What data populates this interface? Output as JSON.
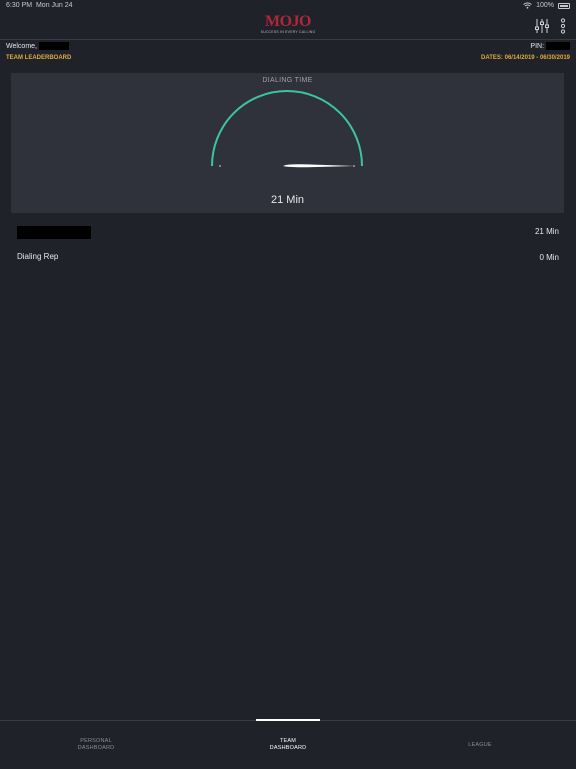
{
  "status_bar": {
    "time": "6:30 PM",
    "date": "Mon Jun 24",
    "battery": "100%"
  },
  "header": {
    "logo_text": "MOJO",
    "logo_tagline": "SUCCESS IN EVERY CALLING",
    "filter_icon": "sliders-icon",
    "more_icon": "vertical-dots-icon"
  },
  "welcome": {
    "label": "Welcome,",
    "pin_label": "PIN:"
  },
  "leaderboard": {
    "title": "TEAM LEADERBOARD",
    "dates": "DATES: 06/14/2019 - 06/30/2019"
  },
  "gauge": {
    "title": "DIALING TIME",
    "value_label": "21 Min",
    "fraction": 0.0,
    "arc_color": "#3cc3a3"
  },
  "list": [
    {
      "name": "",
      "value": "21 Min"
    },
    {
      "name": "Dialing Rep",
      "value": "0 Min"
    }
  ],
  "tabs": [
    {
      "label": "PERSONAL\nDASHBOARD",
      "active": false
    },
    {
      "label": "TEAM\nDASHBOARD",
      "active": true
    },
    {
      "label": "LEAGUE",
      "active": false
    }
  ]
}
